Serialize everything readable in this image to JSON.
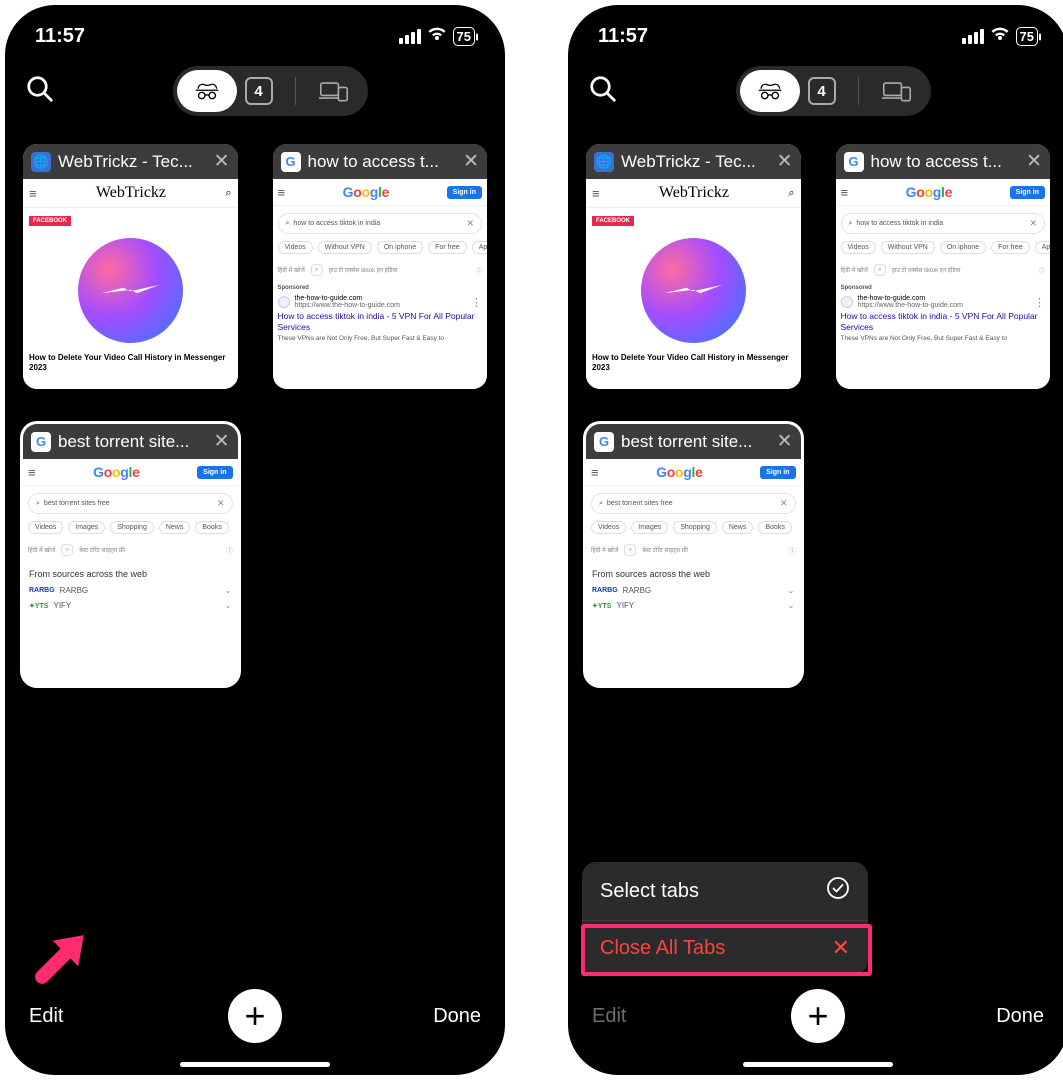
{
  "status": {
    "time": "11:57",
    "battery": "75"
  },
  "topbar": {
    "tab_count": "4"
  },
  "tabs": [
    {
      "title": "WebTrickz - Tec...",
      "kind": "webtrickz",
      "wt": {
        "brand": "WebTrickz",
        "tag": "FACEBOOK",
        "headline": "How to Delete Your Video Call History in Messenger 2023"
      }
    },
    {
      "title": "how to access t...",
      "kind": "google",
      "g": {
        "signin": "Sign in",
        "query": "how to access tiktok in india",
        "chips": [
          "Videos",
          "Without VPN",
          "On iphone",
          "For free",
          "Ap"
        ],
        "hindi_prompt": "हिंदी में खोजें",
        "hindi_hint": "हाउ टो एक्सेस tiktok इन इंडिया",
        "sponsored": "Sponsored",
        "domain": "the-how-to-guide.com",
        "domain_url": "https://www.the-how-to-guide.com",
        "result_title": "How to access tiktok in india - 5 VPN For All Popular Services",
        "result_desc": "These VPNs are Not Only Free, But Super Fast & Easy to"
      }
    },
    {
      "title": "best torrent site...",
      "kind": "google2",
      "g": {
        "signin": "Sign in",
        "query": "best torrent sites free",
        "chips": [
          "Videos",
          "Images",
          "Shopping",
          "News",
          "Books"
        ],
        "hindi_prompt": "हिंदी में खोजें",
        "hindi_hint": "बेस्ट टोरेंट साइट्स फ्री",
        "web_head": "From sources across the web",
        "rows": [
          {
            "logo": "RARBG",
            "logo_color": "#1538b5",
            "label": "RARBG"
          },
          {
            "logo": "✦YTS",
            "logo_color": "#2e9e2e",
            "label": "YIFY"
          }
        ]
      }
    }
  ],
  "bottom": {
    "edit": "Edit",
    "done": "Done"
  },
  "popup": {
    "select": "Select tabs",
    "close_all": "Close All Tabs"
  }
}
